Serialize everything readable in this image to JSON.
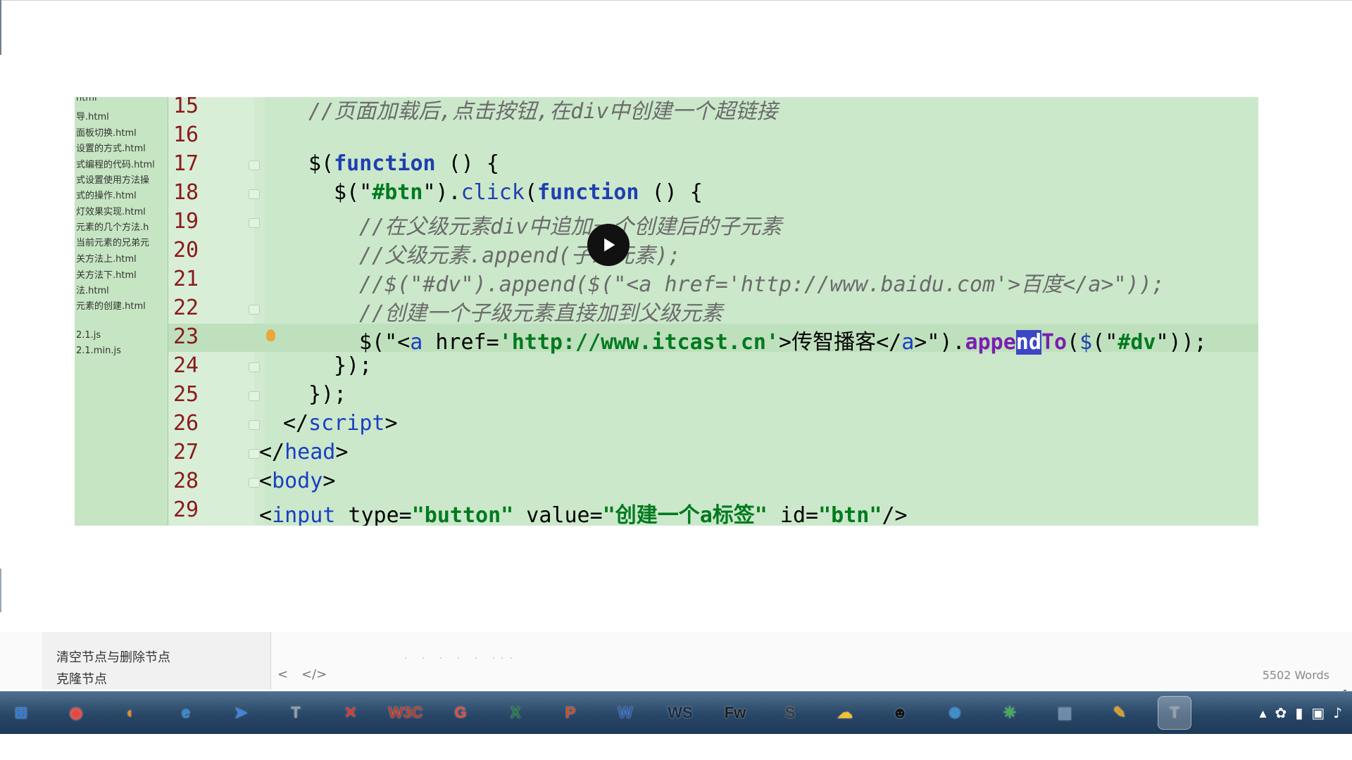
{
  "editor": {
    "files": [
      "html",
      "导.html",
      "面板切换.html",
      "设置的方式.html",
      "式编程的代码.html",
      "式设置使用方法操",
      "式的操作.html",
      "灯效果实现.html",
      "元素的几个方法.h",
      "当前元素的兄弟元",
      "关方法上.html",
      "关方法下.html",
      "法.html",
      "元素的创建.html",
      "",
      "2.1.js",
      "2.1.min.js"
    ],
    "line_numbers": [
      "15",
      "16",
      "17",
      "18",
      "19",
      "20",
      "21",
      "22",
      "23",
      "24",
      "25",
      "26",
      "27",
      "28",
      "29"
    ],
    "code": {
      "l15": "//页面加载后,点击按钮,在div中创建一个超链接",
      "l17_a": "$(",
      "l17_b": "function",
      "l17_c": " () {",
      "l18_a": "$(\"",
      "l18_b": "#btn",
      "l18_c": "\").",
      "l18_d": "click",
      "l18_e": "(",
      "l18_f": "function",
      "l18_g": " () {",
      "l19": "//在父级元素div中追加一个创建后的子元素",
      "l20_a": "//父级元素.append(",
      "l20_b": "子级元素);",
      "l21": "//$(\"#dv\").append($(\"<a href='http://www.baidu.com'>百度</a>\"));",
      "l22": "//创建一个子级元素直接加到父级元素",
      "l23_a": "$(\"<",
      "l23_b": "a",
      "l23_c": " href=",
      "l23_d": "'http://www.itcast.cn'",
      "l23_e": ">传智播客</",
      "l23_f": "a",
      "l23_g": ">\").",
      "l23_h": "appe",
      "l23_i": "nd",
      "l23_j": "To",
      "l23_k": "(",
      "l23_l": "$",
      "l23_m": "(\"",
      "l23_n": "#dv",
      "l23_o": "\"));",
      "l24": "});",
      "l25": "});",
      "l26_a": "</",
      "l26_b": "script",
      "l26_c": ">",
      "l27_a": "</",
      "l27_b": "head",
      "l27_c": ">",
      "l28_a": "<",
      "l28_b": "body",
      "l28_c": ">",
      "l29_a": "<",
      "l29_b": "input",
      "l29_c": " type=",
      "l29_d": "\"button\"",
      "l29_e": " value=",
      "l29_f": "\"创建一个a标签\"",
      "l29_g": " id=",
      "l29_h": "\"btn\"",
      "l29_i": "/>"
    }
  },
  "notes": {
    "items": [
      "清空节点与删除节点",
      "克隆节点"
    ],
    "prev_label": "<",
    "code_label": "</>",
    "dots": ". . . .   .   ...",
    "word_count": "5502 Words"
  },
  "taskbar": {
    "icons": [
      {
        "name": "start",
        "glyph": "⊞",
        "color": "#2d7bd6"
      },
      {
        "name": "chrome",
        "glyph": "◉",
        "color": "#e8453c"
      },
      {
        "name": "firefox",
        "glyph": "◐",
        "color": "#f28a1e"
      },
      {
        "name": "ie",
        "glyph": "e",
        "color": "#2a8de0"
      },
      {
        "name": "feiq",
        "glyph": "➤",
        "color": "#3b86e0"
      },
      {
        "name": "typora",
        "glyph": "T",
        "color": "#9aa0a6"
      },
      {
        "name": "xmind",
        "glyph": "✕",
        "color": "#e2362b"
      },
      {
        "name": "w3c",
        "glyph": "W3C",
        "color": "#c0392b"
      },
      {
        "name": "fiddler",
        "glyph": "G",
        "color": "#e74c3c"
      },
      {
        "name": "excel",
        "glyph": "X",
        "color": "#1d7a3a"
      },
      {
        "name": "powerpoint",
        "glyph": "P",
        "color": "#d14e24"
      },
      {
        "name": "word",
        "glyph": "W",
        "color": "#2b5fb4"
      },
      {
        "name": "webstorm",
        "glyph": "WS",
        "color": "#1b2a40"
      },
      {
        "name": "fireworks",
        "glyph": "Fw",
        "color": "#1e1e1e"
      },
      {
        "name": "sublime",
        "glyph": "S",
        "color": "#3a3a3a"
      },
      {
        "name": "chat",
        "glyph": "☁",
        "color": "#f2c230"
      },
      {
        "name": "qq",
        "glyph": "☻",
        "color": "#111111"
      },
      {
        "name": "player",
        "glyph": "⊛",
        "color": "#2d8fd6"
      },
      {
        "name": "atom",
        "glyph": "✳",
        "color": "#39b54a"
      },
      {
        "name": "explorer",
        "glyph": "▤",
        "color": "#6a8ba8"
      },
      {
        "name": "paint",
        "glyph": "✎",
        "color": "#e0a020"
      },
      {
        "name": "typora-active",
        "glyph": "T",
        "color": "#9aa0a6"
      }
    ]
  }
}
